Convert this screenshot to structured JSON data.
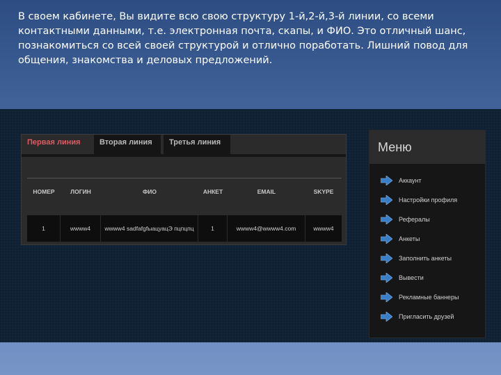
{
  "intro": {
    "lines": [
      "В своем кабинете, Вы видите всю свою структуру 1-й,2-й,3-й линии, со всеми",
      "контактными данными, т.е. электронная почта, скапы, и ФИО. Это отличный шанс,",
      "познакомиться со всей своей структурой и отлично поработать. Лишний повод для",
      "общения, знакомства и деловых предложений."
    ]
  },
  "tabs": [
    "Первая линия",
    "Вторая линия",
    "Третья линия"
  ],
  "table": {
    "columns": [
      "НОМЕР",
      "ЛОГИН",
      "ФИО",
      "АНКЕТ",
      "EMAIL",
      "SKYPE"
    ],
    "rows": [
      [
        "1",
        "wwww4",
        "wwww4 sadfafgfыацуацЭ пцпцпц",
        "1",
        "wwww4@wwww4.com",
        "wwww4"
      ]
    ]
  },
  "menu": {
    "title": "Меню",
    "items": [
      "Аккаунт",
      "Настройки профиля",
      "Рефералы",
      "Анкеты",
      "Заполнить анкеты",
      "Вывести",
      "Рекламные баннеры",
      "Пригласить друзей"
    ]
  },
  "colors": {
    "accent": "#e05a63",
    "arrow": "#3a7ec8"
  }
}
